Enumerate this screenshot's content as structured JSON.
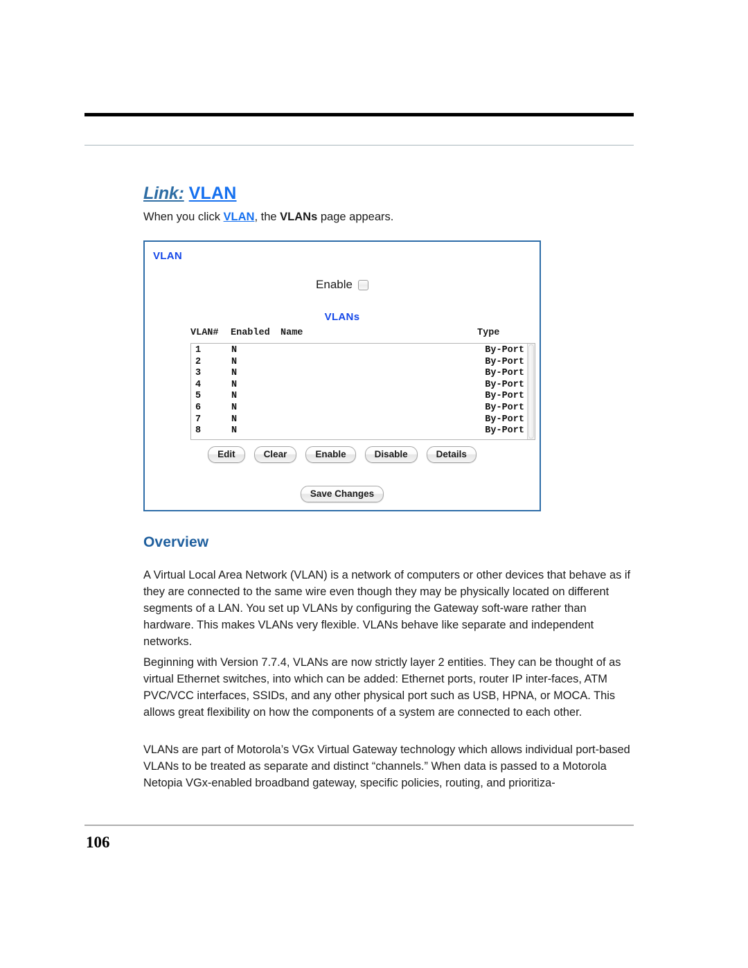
{
  "document": {
    "page_number": "106"
  },
  "section": {
    "link_heading_label": "Link:",
    "link_heading_value": "VLAN",
    "intro_prefix": "When you click ",
    "intro_link": "VLAN",
    "intro_middle": ", the ",
    "intro_bold": "VLANs",
    "intro_suffix": " page appears."
  },
  "screenshot": {
    "panel_title": "VLAN",
    "enable_label": "Enable",
    "enable_checked": false,
    "vlans_title": "VLANs",
    "table": {
      "headers": [
        "VLAN#",
        "Enabled",
        "Name",
        "Type"
      ],
      "rows": [
        {
          "num": "1",
          "enabled": "N",
          "name": "",
          "type": "By-Port"
        },
        {
          "num": "2",
          "enabled": "N",
          "name": "",
          "type": "By-Port"
        },
        {
          "num": "3",
          "enabled": "N",
          "name": "",
          "type": "By-Port"
        },
        {
          "num": "4",
          "enabled": "N",
          "name": "",
          "type": "By-Port"
        },
        {
          "num": "5",
          "enabled": "N",
          "name": "",
          "type": "By-Port"
        },
        {
          "num": "6",
          "enabled": "N",
          "name": "",
          "type": "By-Port"
        },
        {
          "num": "7",
          "enabled": "N",
          "name": "",
          "type": "By-Port"
        },
        {
          "num": "8",
          "enabled": "N",
          "name": "",
          "type": "By-Port"
        }
      ]
    },
    "buttons": [
      "Edit",
      "Clear",
      "Enable",
      "Disable",
      "Details"
    ],
    "save_button": "Save Changes"
  },
  "overview": {
    "heading": "Overview",
    "paragraphs": [
      "A Virtual Local Area Network (VLAN) is a network of computers or other devices that behave as if they are connected to the same wire even though they may be physically located on different segments of a LAN. You set up VLANs by configuring the Gateway soft-ware rather than hardware. This makes VLANs very flexible. VLANs behave like separate and independent networks.",
      "Beginning with Version 7.7.4, VLANs are now strictly layer 2 entities. They can be thought of as virtual Ethernet switches, into which can be added: Ethernet ports, router IP inter-faces, ATM PVC/VCC interfaces, SSIDs, and any other physical port such as USB, HPNA, or MOCA. This allows great flexibility on how the components of a system are connected to each other.",
      "VLANs are part of Motorola’s VGx Virtual Gateway technology which allows individual port-based VLANs to be treated as separate and distinct “channels.” When data is passed to a Motorola Netopia VGx-enabled broadband gateway, specific policies, routing, and prioritiza-"
    ]
  },
  "colors": {
    "link_blue": "#1570ef",
    "heading_blue": "#1f5f9e",
    "panel_border": "#2d6ca8",
    "panel_title_blue": "#1548e8"
  }
}
